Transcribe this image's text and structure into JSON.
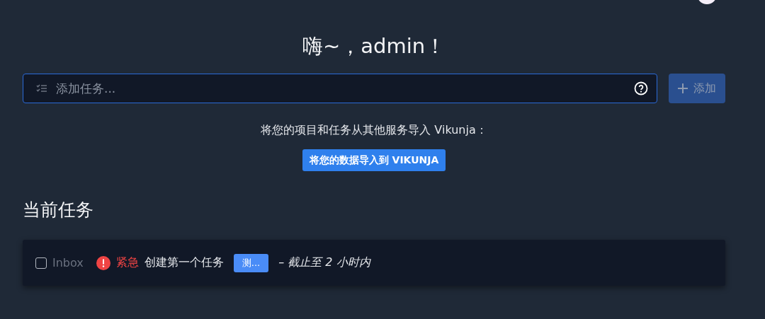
{
  "greeting": "嗨~，admin！",
  "add_task": {
    "placeholder": "添加任务...",
    "button": {
      "label": "添加",
      "disabled": true
    }
  },
  "import": {
    "message": "将您的项目和任务从其他服务导入 Vikunja：",
    "button": "将您的数据导入到 VIKUNJA"
  },
  "current_tasks": {
    "title": "当前任务",
    "tasks": [
      {
        "done": false,
        "project": "Inbox",
        "priority": "紧急",
        "title": "创建第一个任务",
        "label": {
          "text": "测...",
          "color": "#4a8cf7"
        },
        "due": "– 截止至 2 小时内"
      }
    ]
  }
}
